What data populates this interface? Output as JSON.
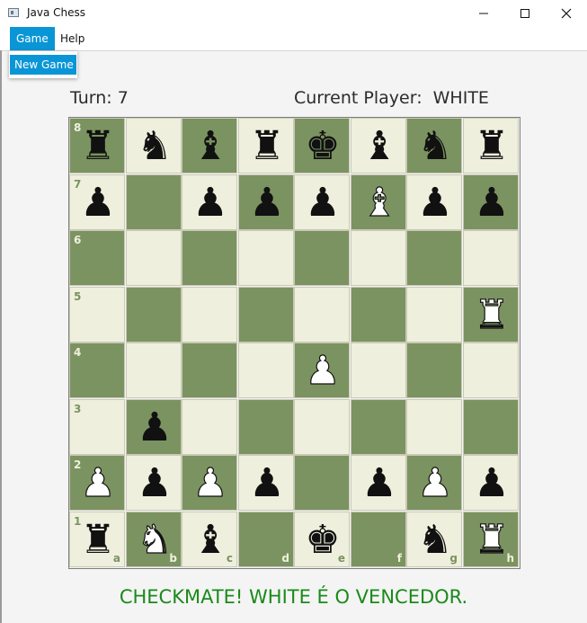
{
  "window": {
    "title": "Java Chess"
  },
  "menu": {
    "items": [
      "Game",
      "Help"
    ],
    "active": "Game",
    "dropdown": [
      "New Game"
    ]
  },
  "info": {
    "turn_label": "Turn:",
    "turn_value": "7",
    "player_label": "Current Player:",
    "player_value": "WHITE"
  },
  "colors": {
    "dark_square": "#7b9360",
    "light_square": "#efefdd",
    "status": "#1a8a1a",
    "accent": "#0a96d6"
  },
  "board": {
    "ranks": [
      "8",
      "7",
      "6",
      "5",
      "4",
      "3",
      "2",
      "1"
    ],
    "files": [
      "a",
      "b",
      "c",
      "d",
      "e",
      "f",
      "g",
      "h"
    ],
    "rows": [
      [
        "bR",
        "bN",
        "bB",
        "bR",
        "bK",
        "bB",
        "bN",
        "bR"
      ],
      [
        "bP",
        "",
        "bP",
        "bP",
        "bP",
        "wB",
        "bP",
        "bP"
      ],
      [
        "",
        "",
        "",
        "",
        "",
        "",
        "",
        ""
      ],
      [
        "",
        "",
        "",
        "",
        "",
        "",
        "",
        "wR"
      ],
      [
        "",
        "",
        "",
        "",
        "wP",
        "",
        "",
        ""
      ],
      [
        "",
        "bP",
        "",
        "",
        "",
        "",
        "",
        ""
      ],
      [
        "wP",
        "bP",
        "wP",
        "bP",
        "",
        "bP",
        "wP",
        "bP"
      ],
      [
        "bR",
        "wN",
        "bB",
        "",
        "bK",
        "",
        "bN",
        "wR"
      ]
    ]
  },
  "status": "CHECKMATE! WHITE É O VENCEDOR."
}
